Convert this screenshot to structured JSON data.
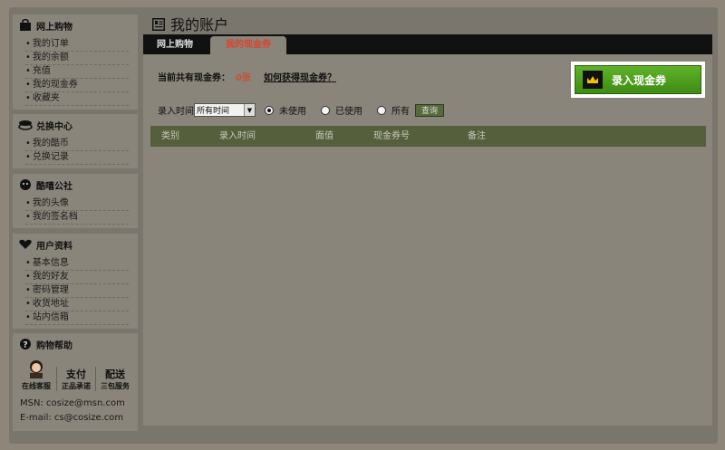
{
  "sidebar": {
    "sections": [
      {
        "title": "网上购物",
        "icon": "shopping-bag-icon",
        "items": [
          "我的订单",
          "我的余额",
          "充值",
          "我的现金券",
          "收藏夹"
        ]
      },
      {
        "title": "兑换中心",
        "icon": "exchange-icon",
        "items": [
          "我的酷币",
          "兑换记录"
        ]
      },
      {
        "title": "酷嘻公社",
        "icon": "community-icon",
        "items": [
          "我的头像",
          "我的签名档"
        ]
      },
      {
        "title": "用户资料",
        "icon": "user-profile-icon",
        "items": [
          "基本信息",
          "我的好友",
          "密码管理",
          "收货地址",
          "站内信箱"
        ]
      }
    ],
    "help": {
      "title": "购物帮助",
      "online_service": "在线客服",
      "payment": "支付",
      "payment_sub": "正品承诺",
      "delivery": "配送",
      "delivery_sub": "三包服务",
      "msn": "MSN: cosize@msn.com",
      "email": "E-mail: cs@cosize.com"
    }
  },
  "main": {
    "title": "我的账户",
    "tabs": [
      {
        "label": "网上购物",
        "active": false
      },
      {
        "label": "我的现金券",
        "active": true
      }
    ],
    "summary_label": "当前共有现金券：",
    "summary_count": "0张",
    "how_to_link": "如何获得现金券？",
    "add_button": "录入现金券",
    "filter": {
      "time_label": "录入时间",
      "time_value": "所有时间",
      "radio_unused": "未使用",
      "radio_used": "已使用",
      "radio_all": "所有",
      "selected": "unused",
      "query_button": "查询"
    },
    "table_headers": [
      "类别",
      "录入时间",
      "面值",
      "现金券号",
      "备注"
    ]
  },
  "colors": {
    "accent_green": "#4a9e1c",
    "active_tab_text": "#d9462a",
    "table_header_bg": "#555f3b"
  }
}
